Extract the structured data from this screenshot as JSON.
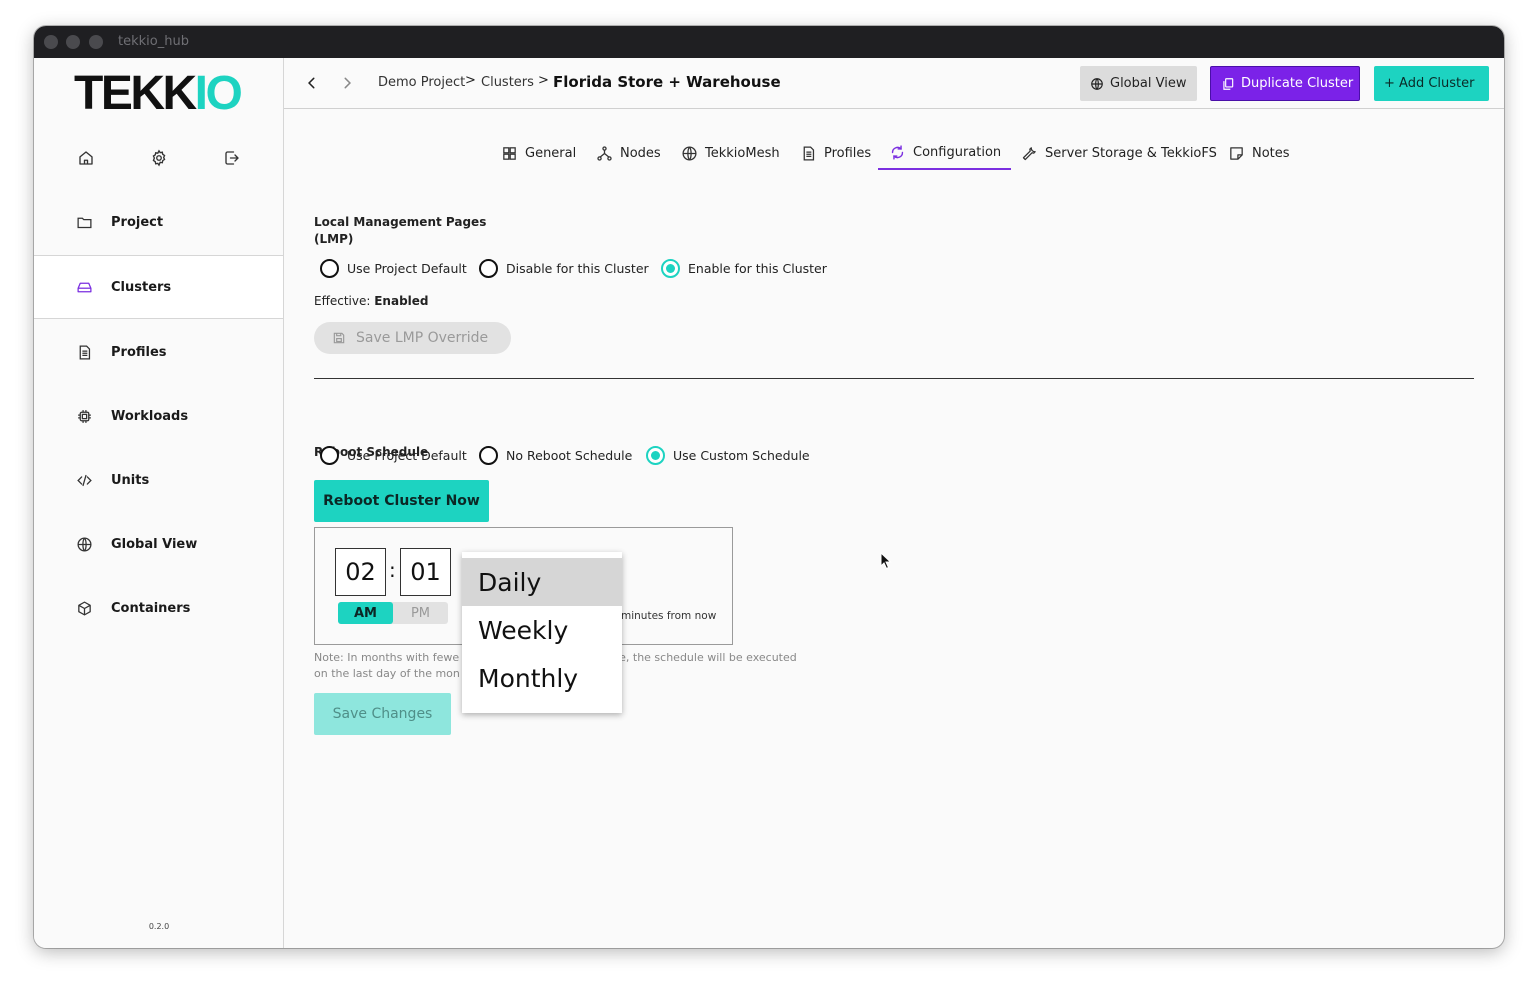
{
  "window": {
    "title": "tekkio_hub"
  },
  "sidebar": {
    "logo": {
      "dark": "TEKK",
      "teal": "IO"
    },
    "quick_icons": [
      "home-icon",
      "gear-icon",
      "logout-icon"
    ],
    "items": [
      {
        "label": "Project",
        "icon": "folder-icon",
        "active": false
      },
      {
        "label": "Clusters",
        "icon": "cluster-icon",
        "active": true
      },
      {
        "label": "Profiles",
        "icon": "document-icon",
        "active": false
      },
      {
        "label": "Workloads",
        "icon": "chip-icon",
        "active": false
      },
      {
        "label": "Units",
        "icon": "code-icon",
        "active": false
      },
      {
        "label": "Global View",
        "icon": "globe-icon",
        "active": false
      },
      {
        "label": "Containers",
        "icon": "box-icon",
        "active": false
      }
    ],
    "version": "0.2.0"
  },
  "topbar": {
    "breadcrumb": {
      "project": "Demo Project",
      "section": "Clusters",
      "current": "Florida Store + Warehouse",
      "separator": ">"
    },
    "buttons": {
      "global_view": "Global View",
      "duplicate": "Duplicate Cluster",
      "add": "+ Add Cluster"
    }
  },
  "tabs": [
    {
      "label": "General",
      "icon": "grid-icon"
    },
    {
      "label": "Nodes",
      "icon": "nodes-icon"
    },
    {
      "label": "TekkioMesh",
      "icon": "globe-icon"
    },
    {
      "label": "Profiles",
      "icon": "document-icon"
    },
    {
      "label": "Configuration",
      "icon": "refresh-icon",
      "active": true
    },
    {
      "label": "Server Storage & TekkioFS",
      "icon": "wrench-icon"
    },
    {
      "label": "Notes",
      "icon": "note-icon"
    }
  ],
  "lmp": {
    "title_line1": "Local Management Pages",
    "title_line2": "(LMP)",
    "options": [
      "Use Project Default",
      "Disable for this Cluster",
      "Enable for this Cluster"
    ],
    "selected": "Enable for this Cluster",
    "effective_label": "Effective:",
    "effective_value": "Enabled",
    "save_label": "Save LMP Override"
  },
  "reboot": {
    "title": "Reboot Schedule",
    "options": [
      "Use Project Default",
      "No Reboot Schedule",
      "Use Custom Schedule"
    ],
    "selected": "Use Custom Schedule",
    "reboot_now_label": "Reboot Cluster Now",
    "hour": "02",
    "minute": "01",
    "am_label": "AM",
    "pm_label": "PM",
    "period": "AM",
    "minutes_text": "minutes from now",
    "note_line1_a": "Note: In months with fewe",
    "note_line1_b": "e, the schedule will be executed",
    "note_line2": "on the last day of the mon",
    "save_label": "Save Changes",
    "frequency_options": [
      "Daily",
      "Weekly",
      "Monthly"
    ],
    "frequency_selected": "Daily"
  },
  "colors": {
    "teal": "#1dd3c1",
    "purple": "#7b22e8"
  }
}
